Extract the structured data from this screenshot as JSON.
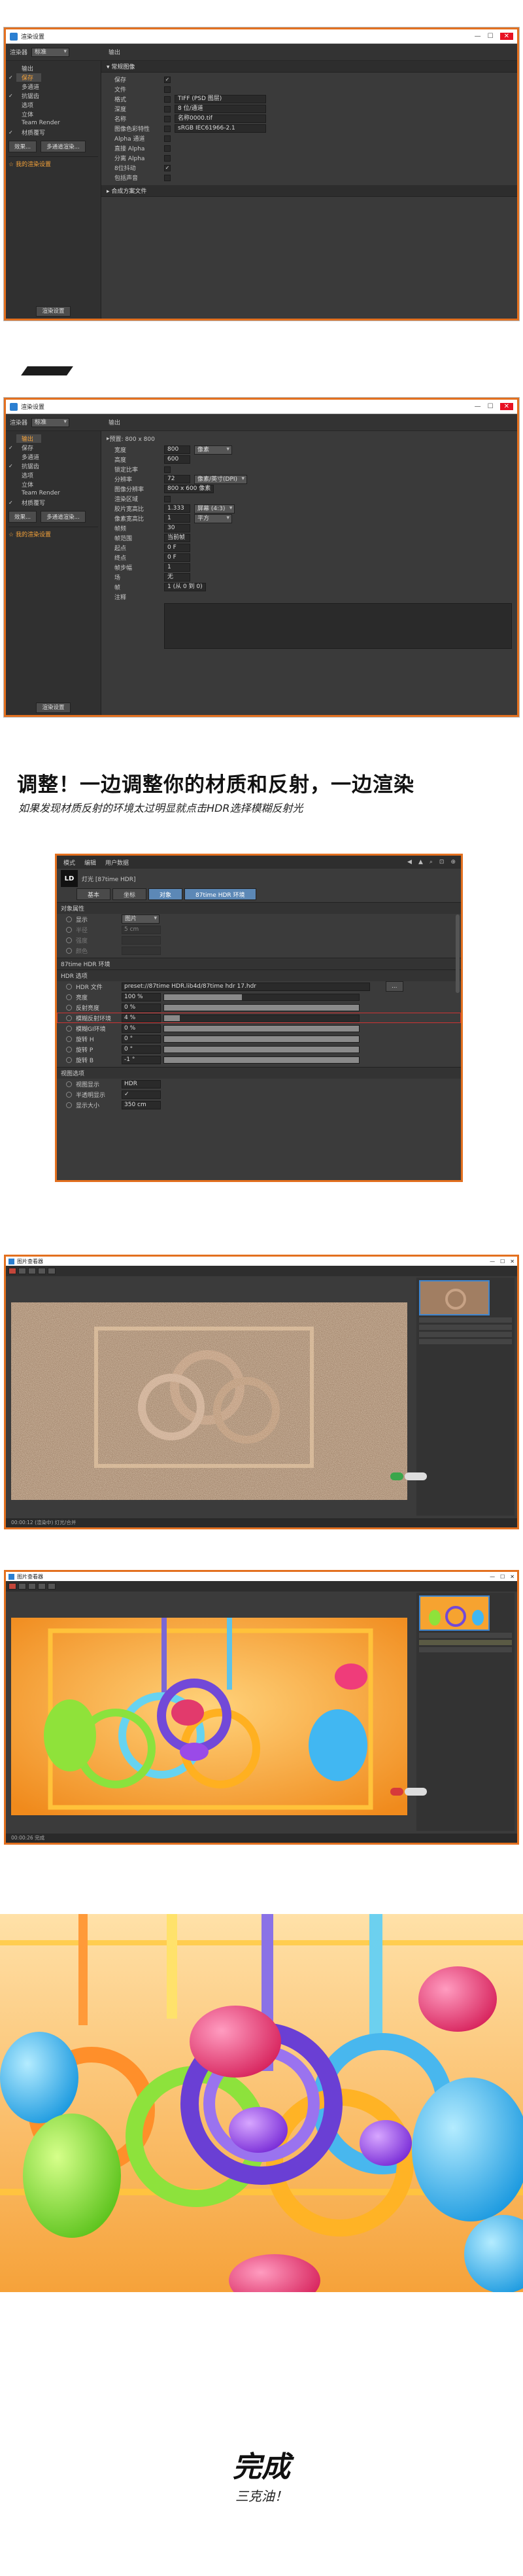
{
  "window1": {
    "title": "渲染设置",
    "renderer_label": "渲染器",
    "renderer_value": "标准",
    "right_label": "输出",
    "left_items": [
      {
        "label": "输出",
        "checked": false
      },
      {
        "label": "保存",
        "checked": true,
        "selected": true
      },
      {
        "label": "多通道",
        "checked": false
      },
      {
        "label": "抗锯齿",
        "checked": true
      },
      {
        "label": "选项",
        "checked": false
      },
      {
        "label": "立体",
        "checked": false
      },
      {
        "label": "Team Render",
        "checked": false
      },
      {
        "label": "材质覆写",
        "checked": true
      }
    ],
    "btn_effect": "效果...",
    "btn_multipass": "多通道渲染...",
    "render_setting_item": "我的渲染设置",
    "btn_add_setting": "渲染设置",
    "section_title": "常规图像",
    "rows": [
      {
        "k": "保存",
        "v": "",
        "check": "✓"
      },
      {
        "k": "文件",
        "v": "",
        "check": ""
      },
      {
        "k": "格式",
        "v": "TIFF (PSD 图层)",
        "check": ""
      },
      {
        "k": "深度",
        "v": "8 位/通道",
        "check": ""
      },
      {
        "k": "名称",
        "v": "名称0000.tif",
        "check": ""
      },
      {
        "k": "图像色彩特性",
        "v": "sRGB IEC61966-2.1",
        "check": ""
      },
      {
        "k": "Alpha 通道",
        "v": "",
        "check": ""
      },
      {
        "k": "直接 Alpha",
        "v": "",
        "check": ""
      },
      {
        "k": "分离 Alpha",
        "v": "",
        "check": ""
      },
      {
        "k": "8位抖动",
        "v": "",
        "check": "✓"
      },
      {
        "k": "包括声音",
        "v": "",
        "check": ""
      }
    ],
    "section2": "合成方案文件"
  },
  "window2": {
    "title": "渲染设置",
    "renderer_label": "渲染器",
    "renderer_value": "标准",
    "right_label": "输出",
    "left_items": [
      {
        "label": "输出",
        "checked": false,
        "selected": true
      },
      {
        "label": "保存",
        "checked": true
      },
      {
        "label": "多通道",
        "checked": false
      },
      {
        "label": "抗锯齿",
        "checked": true
      },
      {
        "label": "选项",
        "checked": false
      },
      {
        "label": "立体",
        "checked": false
      },
      {
        "label": "Team Render",
        "checked": false
      },
      {
        "label": "材质覆写",
        "checked": true
      }
    ],
    "btn_effect": "效果...",
    "btn_multipass": "多通道渲染...",
    "render_setting_item": "我的渲染设置",
    "btn_add_setting": "渲染设置",
    "preset": "预置: 800 x 800",
    "rows": [
      {
        "k": "宽度",
        "v": "800",
        "u": "像素"
      },
      {
        "k": "高度",
        "v": "600",
        "u": ""
      },
      {
        "k": "锁定比率",
        "v": "",
        "u": ""
      },
      {
        "k": "分辨率",
        "v": "72",
        "u": "像素/英寸(DPI)"
      },
      {
        "k": "图像分辨率",
        "v": "800 x 600 像素",
        "u": ""
      },
      {
        "k": "渲染区域",
        "v": "",
        "u": ""
      },
      {
        "k": "胶片宽高比",
        "v": "1.333",
        "u": "屏幕 (4:3)"
      },
      {
        "k": "像素宽高比",
        "v": "1",
        "u": "平方"
      },
      {
        "k": "帧频",
        "v": "30",
        "u": ""
      },
      {
        "k": "帧范围",
        "v": "当前帧",
        "u": ""
      },
      {
        "k": "起点",
        "v": "0 F",
        "u": ""
      },
      {
        "k": "终点",
        "v": "0 F",
        "u": ""
      },
      {
        "k": "帧步幅",
        "v": "1",
        "u": ""
      },
      {
        "k": "场",
        "v": "无",
        "u": ""
      },
      {
        "k": "帧",
        "v": "1 (从 0 到 0)",
        "u": ""
      },
      {
        "k": "注释",
        "v": "",
        "u": ""
      }
    ]
  },
  "heading": "调整！一边调整你的材质和反射，一边渲染",
  "subhead": "如果发现材质反射的环境太过明显就点击HDR选择模糊反射光",
  "attr": {
    "menu": [
      "模式",
      "编辑",
      "用户数据"
    ],
    "object_name": "灯光 [87time HDR]",
    "logo": "LD",
    "tabs": [
      {
        "label": "基本",
        "on": false
      },
      {
        "label": "坐标",
        "on": false
      },
      {
        "label": "对象",
        "on": true
      },
      {
        "label": "87time HDR 环境",
        "on": true
      }
    ],
    "sect_object": "对象属性",
    "display_label": "显示",
    "display_value": "图片",
    "dim_rows": [
      "半径",
      "强度",
      "颜色"
    ],
    "dim_values": [
      "5 cm",
      "",
      ""
    ],
    "sect_hdr_env": "87time HDR 环境",
    "sect_hdr_opt": "HDR 选项",
    "hdr_rows": [
      {
        "k": "HDR 文件",
        "v": "preset://87time HDR.lib4d/87time hdr 17.hdr",
        "bar": null
      },
      {
        "k": "亮度",
        "v": "100 %",
        "bar": 40
      },
      {
        "k": "反射亮度",
        "v": "0 %",
        "bar": 100
      },
      {
        "k": "模糊反射环境",
        "v": "4 %",
        "bar": 8
      },
      {
        "k": "模糊GI环境",
        "v": "0 %",
        "bar": 100
      },
      {
        "k": "旋转 H",
        "v": "0 °",
        "bar": 100
      },
      {
        "k": "旋转 P",
        "v": "0 °",
        "bar": 100
      },
      {
        "k": "旋转 B",
        "v": "-1 °",
        "bar": 100
      }
    ],
    "sect_view": "视图选项",
    "view_rows": [
      {
        "k": "视图显示",
        "v": "HDR"
      },
      {
        "k": "半透明显示",
        "v": "✓"
      },
      {
        "k": "显示大小",
        "v": "350 cm"
      }
    ]
  },
  "vp1": {
    "title": "图片查看器",
    "status": "00:00:12 (渲染中)  灯光/合并"
  },
  "vp2": {
    "title": "图片查看器",
    "status": "00:00:26 完成"
  },
  "final_title": "完成",
  "final_sub": "三克油！",
  "colors": {
    "accent": "#e3701f",
    "selection": "#f4a23a",
    "tab_active": "#5c88b6"
  }
}
